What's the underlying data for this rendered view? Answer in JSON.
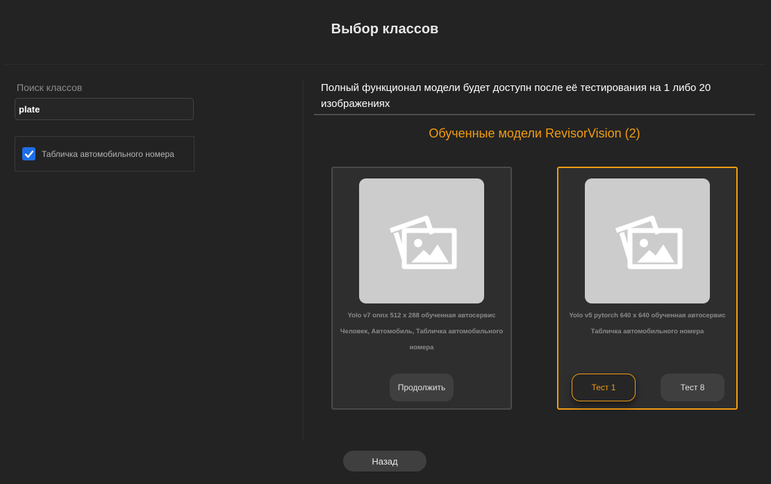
{
  "dialog": {
    "title": "Выбор классов"
  },
  "search": {
    "label": "Поиск классов",
    "value": "plate",
    "placeholder": ""
  },
  "classes": [
    {
      "label": "Табличка автомобильного номера",
      "checked": true
    }
  ],
  "notice": "Полный функционал модели будет доступн после её тестирования на 1 либо 20 изображениях",
  "models_section": {
    "title": "Обученные модели RevisorVision (2)"
  },
  "models": [
    {
      "description": "Yolo v7 onnx 512 x 288 обученная автосервис Человек, Автомобиль, Табличка автомобильного номера",
      "selected": false,
      "buttons": [
        "Продолжить"
      ]
    },
    {
      "description": "Yolo v5 pytorch 640 x 640 обученная автосервис Табличка автомобильного номера",
      "selected": true,
      "buttons": [
        "Тест 1",
        "Тест 8"
      ]
    }
  ],
  "back_label": "Назад",
  "colors": {
    "accent": "#f39c12",
    "checkbox": "#1f6ee8",
    "background": "#232323"
  },
  "icons": {
    "model_placeholder": "images-icon",
    "checkbox": "checkmark-icon"
  }
}
